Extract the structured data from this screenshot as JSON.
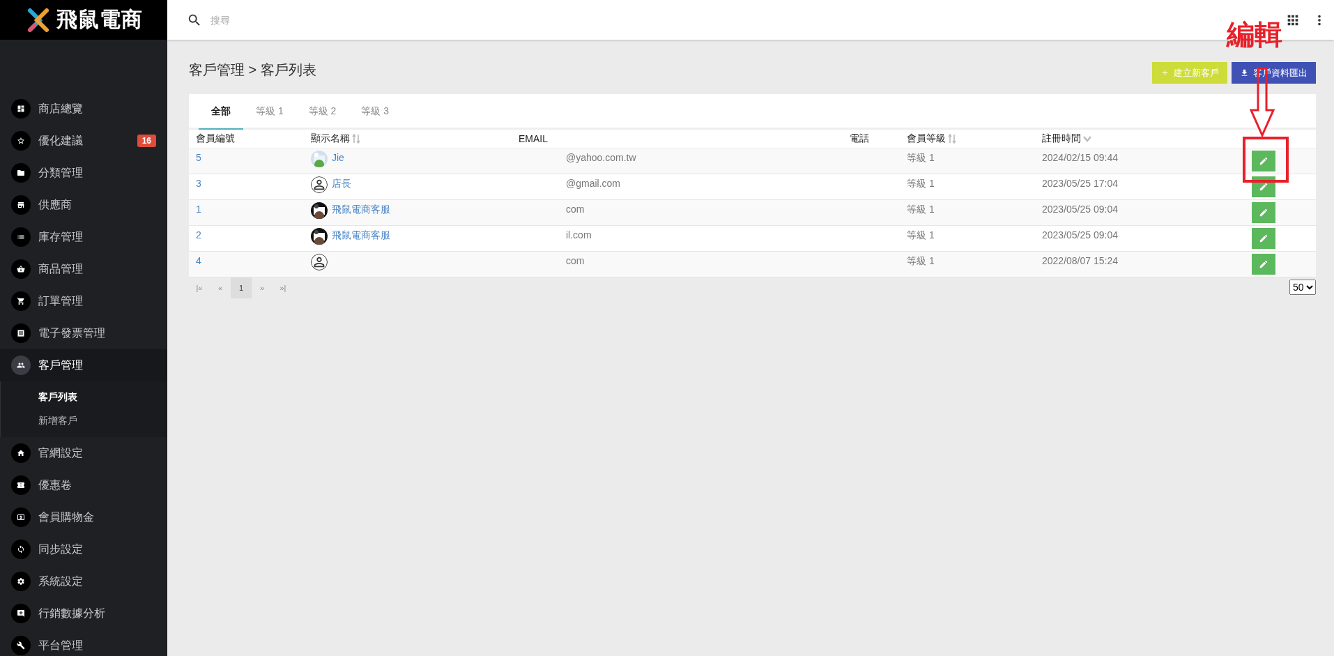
{
  "brand": {
    "name": "飛鼠電商"
  },
  "search": {
    "placeholder": "搜尋"
  },
  "sidebar": {
    "items": [
      {
        "label": "商店總覽",
        "selected": false
      },
      {
        "label": "優化建議",
        "selected": false,
        "badge": "16"
      },
      {
        "label": "分類管理",
        "selected": false
      },
      {
        "label": "供應商",
        "selected": false
      },
      {
        "label": "庫存管理",
        "selected": false
      },
      {
        "label": "商品管理",
        "selected": false
      },
      {
        "label": "訂單管理",
        "selected": false
      },
      {
        "label": "電子發票管理",
        "selected": false
      },
      {
        "label": "客戶管理",
        "selected": true,
        "expanded": true,
        "children": [
          {
            "label": "客戶列表",
            "selected": true
          },
          {
            "label": "新增客戶",
            "selected": false
          }
        ]
      },
      {
        "label": "官網設定",
        "selected": false
      },
      {
        "label": "優惠卷",
        "selected": false
      },
      {
        "label": "會員購物金",
        "selected": false
      },
      {
        "label": "同步設定",
        "selected": false
      },
      {
        "label": "系統設定",
        "selected": false
      },
      {
        "label": "行銷數據分析",
        "selected": false
      },
      {
        "label": "平台管理",
        "selected": false
      }
    ]
  },
  "breadcrumb": {
    "section": "客戶管理",
    "separator": ">",
    "page": "客戶列表"
  },
  "actions": [
    {
      "kind": "create",
      "label": "建立新客戶"
    },
    {
      "kind": "export",
      "label": "客戶資料匯出"
    }
  ],
  "tabs": [
    {
      "label": "全部",
      "selected": true
    },
    {
      "label": "等級 1",
      "selected": false
    },
    {
      "label": "等級 2",
      "selected": false
    },
    {
      "label": "等級 3",
      "selected": false
    }
  ],
  "table": {
    "columns": [
      {
        "label": "會員編號",
        "sortable": false,
        "sorted": false
      },
      {
        "label": "顯示名稱",
        "sortable": true,
        "sorted": false
      },
      {
        "label": "EMAIL",
        "sortable": false,
        "sorted": false
      },
      {
        "label": "電話",
        "sortable": false,
        "sorted": false
      },
      {
        "label": "會員等級",
        "sortable": true,
        "sorted": false
      },
      {
        "label": "註冊時間",
        "sortable": true,
        "sorted": true
      }
    ],
    "rows": [
      {
        "id": "5",
        "photo": true,
        "name": "Jie",
        "email": "@yahoo.com.tw",
        "level": "等級 1",
        "registered": "2024/02/15 09:44"
      },
      {
        "id": "3",
        "photo": false,
        "name": "店長",
        "email": "@gmail.com",
        "level": "等級 1",
        "registered": "2023/05/25 17:04"
      },
      {
        "id": "1",
        "photo": true,
        "name": "飛鼠電商客服",
        "email": "com",
        "level": "等級 1",
        "registered": "2023/05/25 09:04"
      },
      {
        "id": "2",
        "photo": true,
        "name": "飛鼠電商客服",
        "email": "il.com",
        "level": "等級 1",
        "registered": "2023/05/25 09:04"
      },
      {
        "id": "4",
        "photo": false,
        "email": "com",
        "level": "等級 1",
        "registered": "2022/08/07 15:24"
      }
    ]
  },
  "pagination": {
    "pages": [
      {
        "label": "|«",
        "selected": false
      },
      {
        "label": "«",
        "selected": false
      },
      {
        "label": "1",
        "selected": true
      },
      {
        "label": "»",
        "selected": false
      },
      {
        "label": "»|",
        "selected": false
      }
    ],
    "page_size": "50"
  },
  "annotation": {
    "label": "編輯"
  }
}
